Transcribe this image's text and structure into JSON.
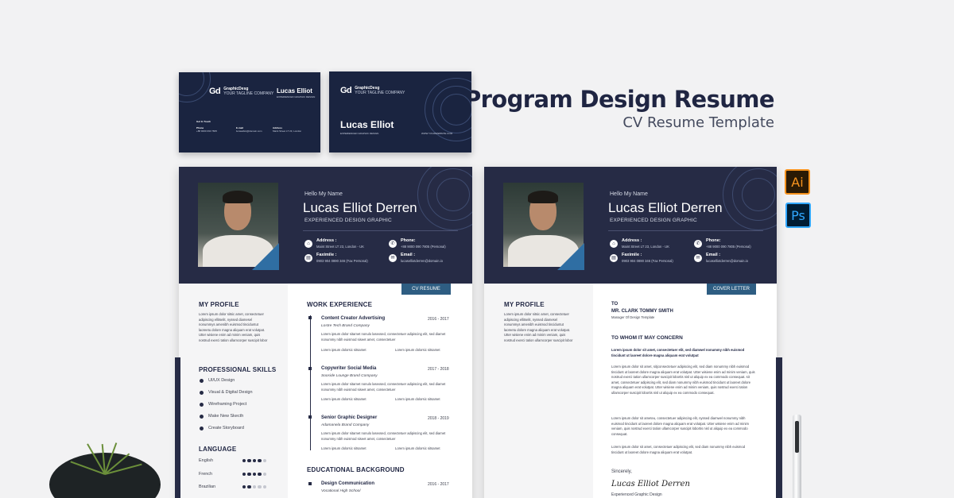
{
  "heading": {
    "title": "Program Design Resume",
    "subtitle": "CV Resume Template"
  },
  "card_back": {
    "brand": "GraphicDesg",
    "brand_tag": "YOUR TAGLINE COMPANY",
    "name": "Lucas Elliot",
    "role": "EXPERIENCED GRAPHIC DESIGN",
    "get_in_touch": "Get In Touch",
    "phone_label": "Phone",
    "phone_value": "+88 9000 090 7805",
    "email_label": "E-mail",
    "email_value": "lucaselliot@domain.com",
    "address_label": "Address",
    "address_value": "Maint Street LT 23, London"
  },
  "card_front": {
    "brand": "GraphicDesg",
    "brand_tag": "YOUR TAGLINE COMPANY",
    "name": "Lucas Elliot",
    "role": "EXPERIENCED GRAPHIC DESIGN",
    "website": "WWW.YOURWEBSITE.COM"
  },
  "resume": {
    "hello": "Hello My Name",
    "name": "Lucas Elliot Derren",
    "role": "EXPERIENCED DESIGN GRAPHIC",
    "address_label": "Address :",
    "address_value": "Maint Street LT 23, London - UK",
    "phone_label": "Phone:",
    "phone_value": "+88 9000 090 7805 (Personal)",
    "fax_label": "Faximile :",
    "fax_value": "0903 904 0890 346 (Fax Personal)",
    "email_label": "Email :",
    "email_value": "lucaselliotderren@domain.io",
    "tag": "CV RESUME",
    "profile_title": "MY PROFILE",
    "profile_text": "Lorem ipsum dolor sitsic amet, consectetuer adipiscing ellitselit, nyssed diamesel nonummys amenibh euismod tinciduntut laoreetu dolore magna aliquam erat volutpat. Utter wisiene enim ad minim veniam, quis nostrud exerci tation ullamcorper suscipit lobor",
    "skills_title": "PROFESSIONAL SKILLS",
    "skills": [
      "UI/UX Design",
      "Visual & Digital Design",
      "Wireframing Project",
      "Make New Skecth",
      "Create Storyboard"
    ],
    "language_title": "LANGUAGE",
    "languages": [
      {
        "name": "English",
        "level": 4
      },
      {
        "name": "French",
        "level": 4
      },
      {
        "name": "Brazilian",
        "level": 2
      }
    ],
    "work_title": "WORK EXPERIENCE",
    "jobs": [
      {
        "title": "Content Creator Advertising",
        "years": "2016 - 2017",
        "company": "Lostre Tech Brand Company"
      },
      {
        "title": "Copywriter Social Media",
        "years": "2017 - 2018",
        "company": "Sooside Lounge Brand Company"
      },
      {
        "title": "Senior Graphic Designer",
        "years": "2018 - 2019",
        "company": "Adamanela Brand Company"
      }
    ],
    "job_text": "Lorem ipsum dolor sitamet nonulo lasexsed, consectetuer adipiscing elit, sed diamet nonummy nibh euismod siseet amet, consectetuer",
    "job_bullet": "Lorem ipsum dolorsic sitsamet",
    "edu_title": "EDUCATIONAL BACKGROUND",
    "edu": [
      {
        "title": "Design Communication",
        "years": "2016 - 2017",
        "school": "Vocational High School"
      }
    ]
  },
  "letter": {
    "hello": "Hello My Name",
    "name": "Lucas Elliot Derren",
    "role": "EXPERIENCED DESIGN GRAPHIC",
    "address_label": "Address :",
    "address_value": "Maint Street LT 23, London - UK",
    "phone_label": "Phone:",
    "phone_value": "+88 9000 090 7805 (Personal)",
    "fax_label": "Faximile :",
    "fax_value": "0903 904 0890 346 (Fax Personal)",
    "email_label": "Email :",
    "email_value": "lucaselliotderren@domain.io",
    "tag": "COVER LETTER",
    "profile_title": "MY PROFILE",
    "profile_text": "Lorem ipsum dolor sitsic amet, consectetuer adipiscing ellitselit, nyssed diamesel nonummys amenibh euismod tinciduntut laoreetu dolore magna aliquam erat volutpat. Utter wisiene enim ad minim veniam, quis nostrud exerci tation ullamcorper suscipit lobor",
    "to": "TO",
    "recipient": "MR. CLARK TOMMY SMITH",
    "recipient_role": "Manager Of Design Template",
    "concern": "TO WHOM IT MAY CONCERN",
    "lead": "Lorem ipsum dolor sit amet, consectetuer elit, sed diamwel nonummy nibh euismod tincidunt ut laoreet dolore magna aliquam erat volutpat",
    "para1": "Lorem ipsum dolor sit amet, sitjconsectetuer adipiscing elit, sed diam nonummy nibh euismod tincidunt ut laoreet dolore magna aliquam erat volutpat. Utter wisiene enim ad minim veniam, quis nostrud exerci tation ullamcorper suscipit lobortis nisl ut aliquip ex ea commodo consequat. sit amet, consectetuer adipiscing elit, sed diam nonummy nibh euismod tincidunt ut laoreet dolore magna aliquam erat volutpat. Utter wisiene enim ad minim veniam, quis nostrud exerci tation ullamcorper suscipit lobortis nisl ut aliquip ex ea commodo consequat.",
    "para2": "Lorem ipsum dolor sit ameteu, consectetuer adipiscing elit, nyssed diamwel nonummy nibh euismod tincidunt ut laoreet dolore magna aliquam erat volutpat. Utter wisiene enim ad minim veniam, quis nostrud exerci tation ullamcorper suscipit lobortis nisl ut aliquip ex ea commodo consequat.",
    "para3": "Lorem ipsum dolor sit amet, consectetuer adipiscing elit, sed diam nonummy nibh euismod tincidunt ut laoreet dolore magna aliquam erat volutpat.",
    "sincerely": "Sincerely,",
    "signature": "Lucas Elliot Derren",
    "sign_role": "Experienced Graphic Design"
  },
  "badges": {
    "ai": "Ai",
    "ps": "Ps",
    "ai_bg": "#2a1a05",
    "ai_fg": "#f7931e",
    "ps_bg": "#001d34",
    "ps_fg": "#31a8ff"
  }
}
